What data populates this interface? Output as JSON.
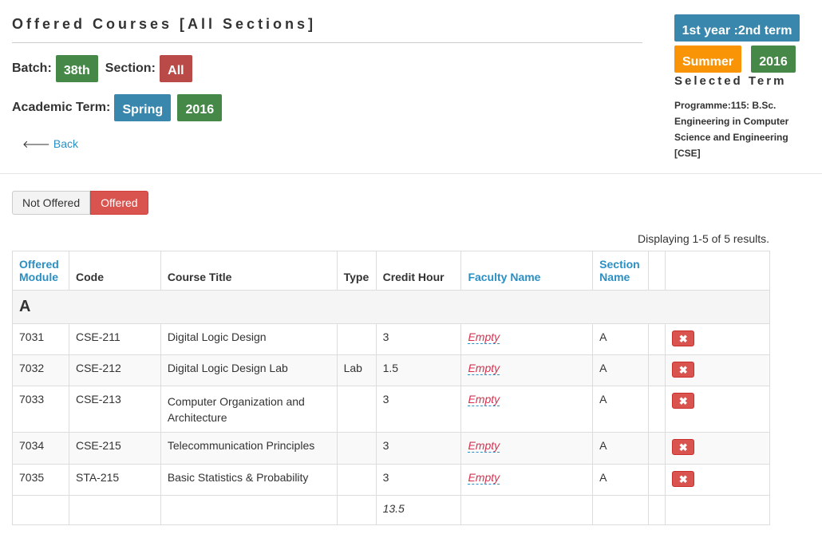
{
  "page": {
    "title": "Offered Courses [All Sections]",
    "batch_label": "Batch:",
    "batch_value": "38th",
    "section_label": "Section:",
    "section_value": "All",
    "term_label": "Academic Term:",
    "term_season": "Spring",
    "term_year": "2016",
    "back_label": "Back"
  },
  "sidebar": {
    "year_term": "1st year :2nd term",
    "selected_season": "Summer",
    "selected_year": "2016",
    "selected_term_label": "Selected Term",
    "programme": "Programme:115: B.Sc. Engineering in Computer Science and Engineering [CSE]"
  },
  "toggle": {
    "not_offered": "Not Offered",
    "offered": "Offered"
  },
  "summary": "Displaying 1-5 of 5 results.",
  "table": {
    "headers": {
      "module_line1": "Offered",
      "module_line2": "Module",
      "code": "Code",
      "title": "Course Title",
      "type": "Type",
      "credit": "Credit Hour",
      "faculty": "Faculty Name",
      "section_line1": "Section",
      "section_line2": "Name"
    },
    "group": "A",
    "rows": [
      {
        "module": "7031",
        "code": "CSE-211",
        "title": "Digital Logic Design",
        "type": "",
        "credit": "3",
        "faculty": "Empty",
        "section": "A"
      },
      {
        "module": "7032",
        "code": "CSE-212",
        "title": "Digital Logic Design Lab",
        "type": "Lab",
        "credit": "1.5",
        "faculty": "Empty",
        "section": "A"
      },
      {
        "module": "7033",
        "code": "CSE-213",
        "title": "Computer Organization and Architecture",
        "type": "",
        "credit": "3",
        "faculty": "Empty",
        "section": "A"
      },
      {
        "module": "7034",
        "code": "CSE-215",
        "title": "Telecommunication Principles",
        "type": "",
        "credit": "3",
        "faculty": "Empty",
        "section": "A"
      },
      {
        "module": "7035",
        "code": "STA-215",
        "title": "Basic Statistics & Probability",
        "type": "",
        "credit": "3",
        "faculty": "Empty",
        "section": "A"
      }
    ],
    "total_credit": "13.5",
    "delete_icon": "✖"
  },
  "colors": {
    "blue_badge": "#3a87ad",
    "green_badge": "#468847",
    "red_badge": "#b94a48",
    "orange_badge": "#f89406",
    "link": "#2a8fc4",
    "danger": "#d9534f"
  }
}
